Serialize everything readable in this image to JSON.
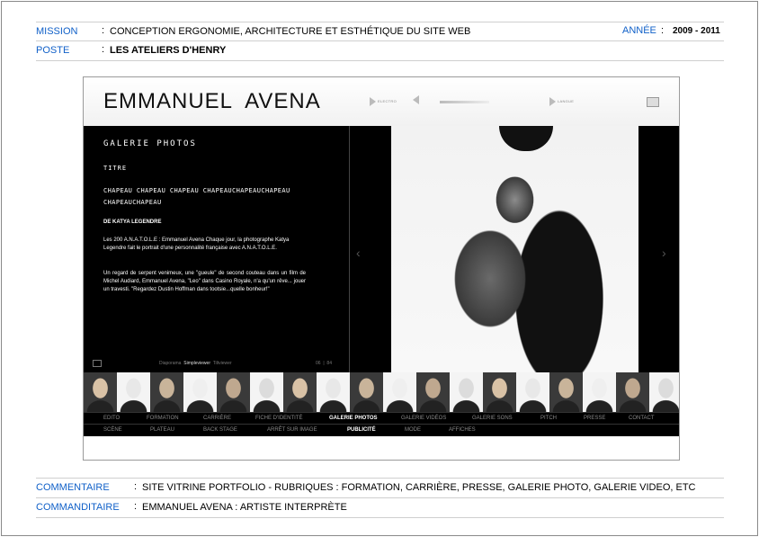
{
  "top": {
    "mission_label": "MISSION",
    "mission_value": "CONCEPTION ERGONOMIE, ARCHITECTURE ET ESTHÉTIQUE DU SITE WEB",
    "year_label": "ANNÉE",
    "year_value": "2009 - 2011",
    "poste_label": "POSTE",
    "poste_value": "LES ATELIERS D'HENRY",
    "colon": ":"
  },
  "site": {
    "name": "EMMANUEL  AVENA",
    "controls": [
      "ELECTRO",
      "LANGUE"
    ],
    "gallery_title": "GALERIE PHOTOS",
    "titre_label": "TITRE",
    "title_text": "CHAPEAU CHAPEAU CHAPEAU CHAPEAUCHAPEAUCHAPEAU CHAPEAUCHAPEAU",
    "author": "DE KATYA LEGENDRE",
    "para1": "Les 200 A.N.A.T.O.L.E : Emmanuel Avena Chaque jour, la photographe Katya Legendre fait le portrait d'une personnalité française avec A.N.A.T.O.L.E.",
    "para2": "Un regard de serpent venimeux, une \"gueule\" de second couteau dans un film de Michel Audiard, Emmanuel Avena, \"Leo\" dans Casino Royale, n'a qu'un rêve... jouer un travesti. \"Regardez Dustin Hoffman dans tootsie...quelle bonheur!\"",
    "viewers": [
      "Diaporama",
      "Simpleviewer",
      "Tiltviewer"
    ],
    "counter_current": "06",
    "counter_total": "84",
    "nav_row1": [
      "EDITO",
      "FORMATION",
      "CARRIÈRE",
      "FICHE D'IDENTITÉ",
      "GALERIE PHOTOS",
      "GALERIE VIDÉOS",
      "GALERIE SONS",
      "PITCH",
      "PRESSE",
      "CONTACT"
    ],
    "nav_row2": [
      "SCÈNE",
      "PLATEAU",
      "BACK STAGE",
      "ARRÊT SUR IMAGE",
      "PUBLICITÉ",
      "MODE",
      "AFFICHES"
    ],
    "nav_row1_active": "GALERIE PHOTOS",
    "nav_row2_active": "PUBLICITÉ"
  },
  "bottom": {
    "comment_label": "COMMENTAIRE",
    "comment_value": "SITE VITRINE PORTFOLIO - RUBRIQUES : FORMATION, CARRIÈRE, PRESSE, GALERIE PHOTO, GALERIE VIDEO, ETC",
    "client_label": "COMMANDITAIRE",
    "client_value": "EMMANUEL AVENA : ARTISTE INTERPRÈTE",
    "colon": ":"
  },
  "colors": {
    "label_blue": "#1060c8",
    "rule": "#cfcfcf"
  }
}
